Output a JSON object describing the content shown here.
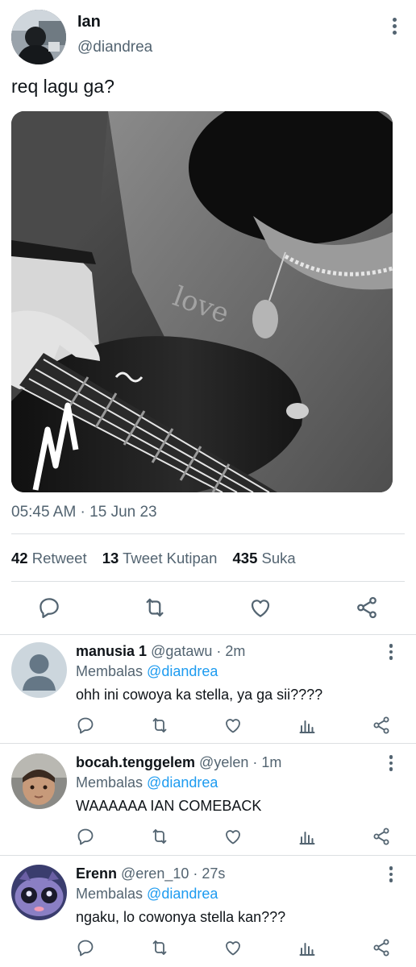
{
  "tweet": {
    "author_name": "Ian",
    "author_handle": "@diandrea",
    "text": "req lagu ga?",
    "timestamp": "05:45 AM · 15 Jun 23",
    "stats": {
      "retweets_count": "42",
      "retweets_label": "Retweet",
      "quotes_count": "13",
      "quotes_label": "Tweet Kutipan",
      "likes_count": "435",
      "likes_label": "Suka"
    },
    "actions": [
      "reply-icon",
      "retweet-icon",
      "like-icon",
      "share-icon"
    ]
  },
  "replies": [
    {
      "name": "manusia 1",
      "handle": "@gatawu",
      "time": "· 2m",
      "replying_label": "Membalas",
      "replying_to": "@diandrea",
      "text": "ohh ini cowoya ka stella, ya ga sii????"
    },
    {
      "name": "bocah.tenggelem",
      "handle": "@yelen",
      "time": "· 1m",
      "replying_label": "Membalas",
      "replying_to": "@diandrea",
      "text": "WAAAAAA IAN COMEBACK"
    },
    {
      "name": "Erenn",
      "handle": "@eren_10",
      "time": "· 27s",
      "replying_label": "Membalas",
      "replying_to": "@diandrea",
      "text": "ngaku, lo cowonya stella kan???"
    }
  ],
  "colors": {
    "text": "#0f1419",
    "secondary": "#536471",
    "link": "#1d9bf0",
    "divider": "#dcdfe2"
  }
}
